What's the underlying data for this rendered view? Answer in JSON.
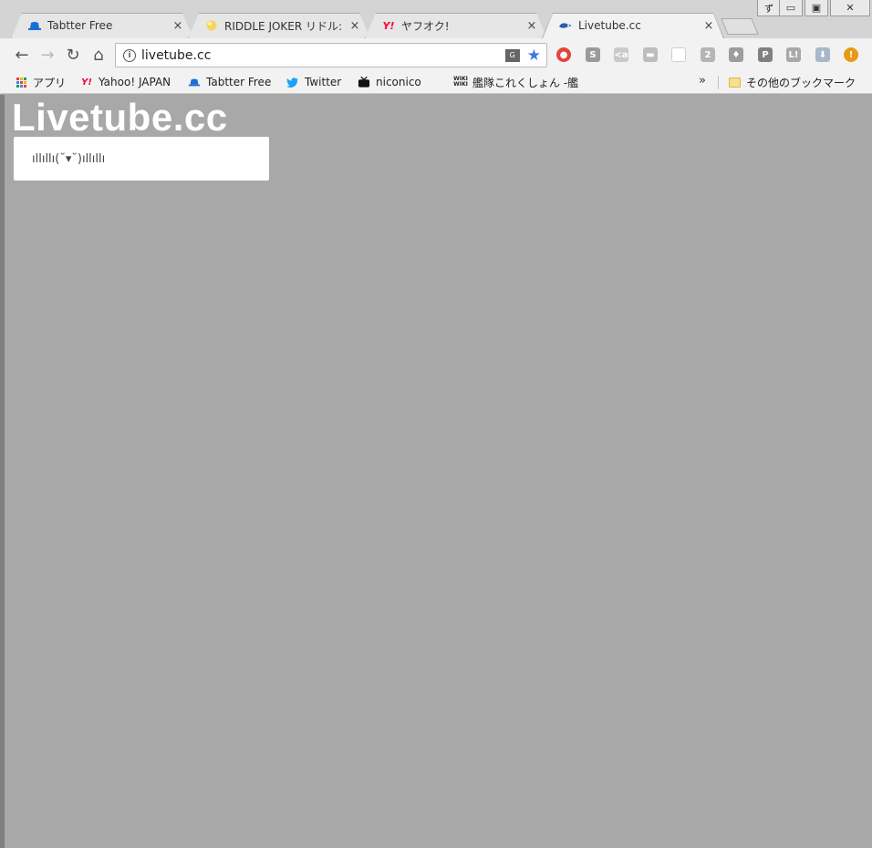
{
  "browser": {
    "tabs": [
      {
        "title": "Tabtter Free",
        "icon": "hat-icon",
        "active": false
      },
      {
        "title": "RIDDLE JOKER リドル:",
        "icon": "star-icon",
        "active": false
      },
      {
        "title": "ヤフオク!",
        "icon": "yahoo-icon",
        "active": false
      },
      {
        "title": "Livetube.cc",
        "icon": "livetube-icon",
        "active": true
      }
    ],
    "tab_close_glyph": "×",
    "window_controls": {
      "profile": "ず",
      "minimize": "▭",
      "maximize": "▣",
      "close": "✕"
    },
    "toolbar": {
      "back_glyph": "←",
      "forward_glyph": "→",
      "reload_glyph": "↻",
      "home_glyph": "⌂",
      "url": "livetube.cc",
      "info_glyph": "i",
      "translate_glyph": "G",
      "star_glyph": "★"
    },
    "extensions": [
      {
        "name": "red-circle-extension-icon",
        "glyph": "●",
        "color": "#e0463b"
      },
      {
        "name": "s-extension-icon",
        "glyph": "S",
        "color": "#9a9a9a"
      },
      {
        "name": "share-extension-icon",
        "glyph": "<a",
        "color": "#c9c9c9"
      },
      {
        "name": "hat-extension-icon",
        "glyph": "▬",
        "color": "#bdbdbd"
      },
      {
        "name": "blank-extension-icon",
        "glyph": "",
        "color": "#ffffff"
      },
      {
        "name": "c-extension-icon",
        "glyph": "2",
        "color": "#b5b5b5"
      },
      {
        "name": "location-extension-icon",
        "glyph": "♦",
        "color": "#9c9c9c"
      },
      {
        "name": "p-extension-icon",
        "glyph": "P",
        "color": "#808080"
      },
      {
        "name": "l-extension-icon",
        "glyph": "L!",
        "color": "#a9a9a9"
      },
      {
        "name": "download-extension-icon",
        "glyph": "⬇",
        "color": "#a8b8c8"
      },
      {
        "name": "warning-extension-icon",
        "glyph": "!",
        "color": "#e89a12"
      }
    ],
    "bookmarks": [
      {
        "label": "アプリ",
        "icon": "apps-grid-icon"
      },
      {
        "label": "Yahoo! JAPAN",
        "icon": "yahoo-icon"
      },
      {
        "label": "Tabtter Free",
        "icon": "hat-icon"
      },
      {
        "label": "Twitter",
        "icon": "twitter-bird-icon"
      },
      {
        "label": "niconico",
        "icon": "tv-icon"
      },
      {
        "label": "艦隊これくしょん -艦",
        "icon": "wiki-icon"
      }
    ],
    "bookmarks_overflow": "»",
    "other_bookmarks": "その他のブックマーク"
  },
  "page": {
    "logo_text": "Livetube.cc",
    "status_text": "ıllıllı(˘▾˘)ıllıllı"
  },
  "colors": {
    "page_background": "#a8a8a8",
    "yahoo_red": "#ff0033",
    "tabtter_blue": "#1a6fd6",
    "twitter_blue": "#1da1f2"
  }
}
